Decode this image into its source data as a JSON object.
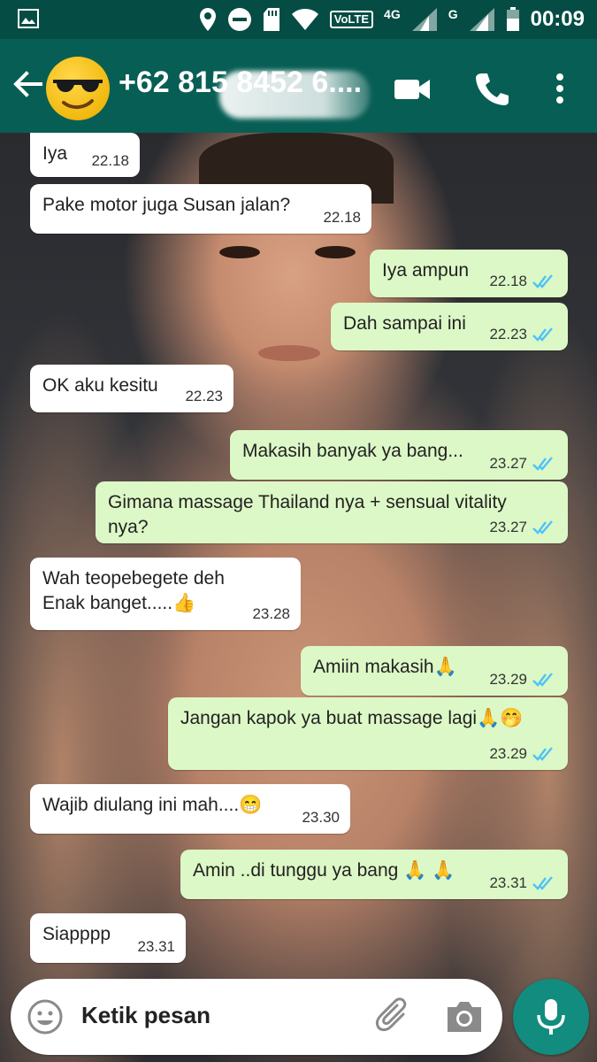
{
  "status_bar": {
    "network_4g": "4G",
    "network_g": "G",
    "volte": "VoLTE",
    "time": "00:09"
  },
  "header": {
    "contact": "+62 815 8452 6....",
    "icons": [
      "back-arrow-icon",
      "avatar-sunglasses-emoji",
      "video-call-icon",
      "phone-icon",
      "more-options-icon"
    ]
  },
  "messages": [
    {
      "dir": "in",
      "text": "Iya",
      "time": "22.18"
    },
    {
      "dir": "in",
      "text": "Pake motor juga Susan jalan?",
      "time": "22.18"
    },
    {
      "dir": "out",
      "text": "Iya ampun",
      "time": "22.18"
    },
    {
      "dir": "out",
      "text": "Dah sampai ini",
      "time": "22.23"
    },
    {
      "dir": "in",
      "text": "OK aku kesitu",
      "time": "22.23"
    },
    {
      "dir": "out",
      "text": "Makasih banyak ya bang...",
      "time": "23.27"
    },
    {
      "dir": "out",
      "text": "Gimana massage Thailand nya + sensual vitality nya?",
      "time": "23.27"
    },
    {
      "dir": "in",
      "text_line1": "Wah teopebegete deh",
      "text_line2": "Enak banget.....",
      "emoji": "👍",
      "time": "23.28"
    },
    {
      "dir": "out",
      "text": "Amiin makasih",
      "emoji": "🙏",
      "time": "23.29"
    },
    {
      "dir": "out",
      "text": "Jangan kapok ya buat massage lagi",
      "emoji": "🙏🤭",
      "time": "23.29"
    },
    {
      "dir": "in",
      "text": "Wajib diulang ini mah....",
      "emoji": "😁",
      "time": "23.30"
    },
    {
      "dir": "out",
      "text": "Amin ..di tunggu ya bang",
      "emoji": "🙏 🙏",
      "time": "23.31"
    },
    {
      "dir": "in",
      "text": "Siapppp",
      "time": "23.31"
    }
  ],
  "input": {
    "placeholder": "Ketik pesan"
  },
  "colors": {
    "status_bar": "#054d44",
    "app_bar": "#075e54",
    "outgoing_bubble": "#dcf8c6",
    "incoming_bubble": "#ffffff",
    "read_ticks": "#4fc3f7",
    "mic_button": "#128c7e"
  }
}
